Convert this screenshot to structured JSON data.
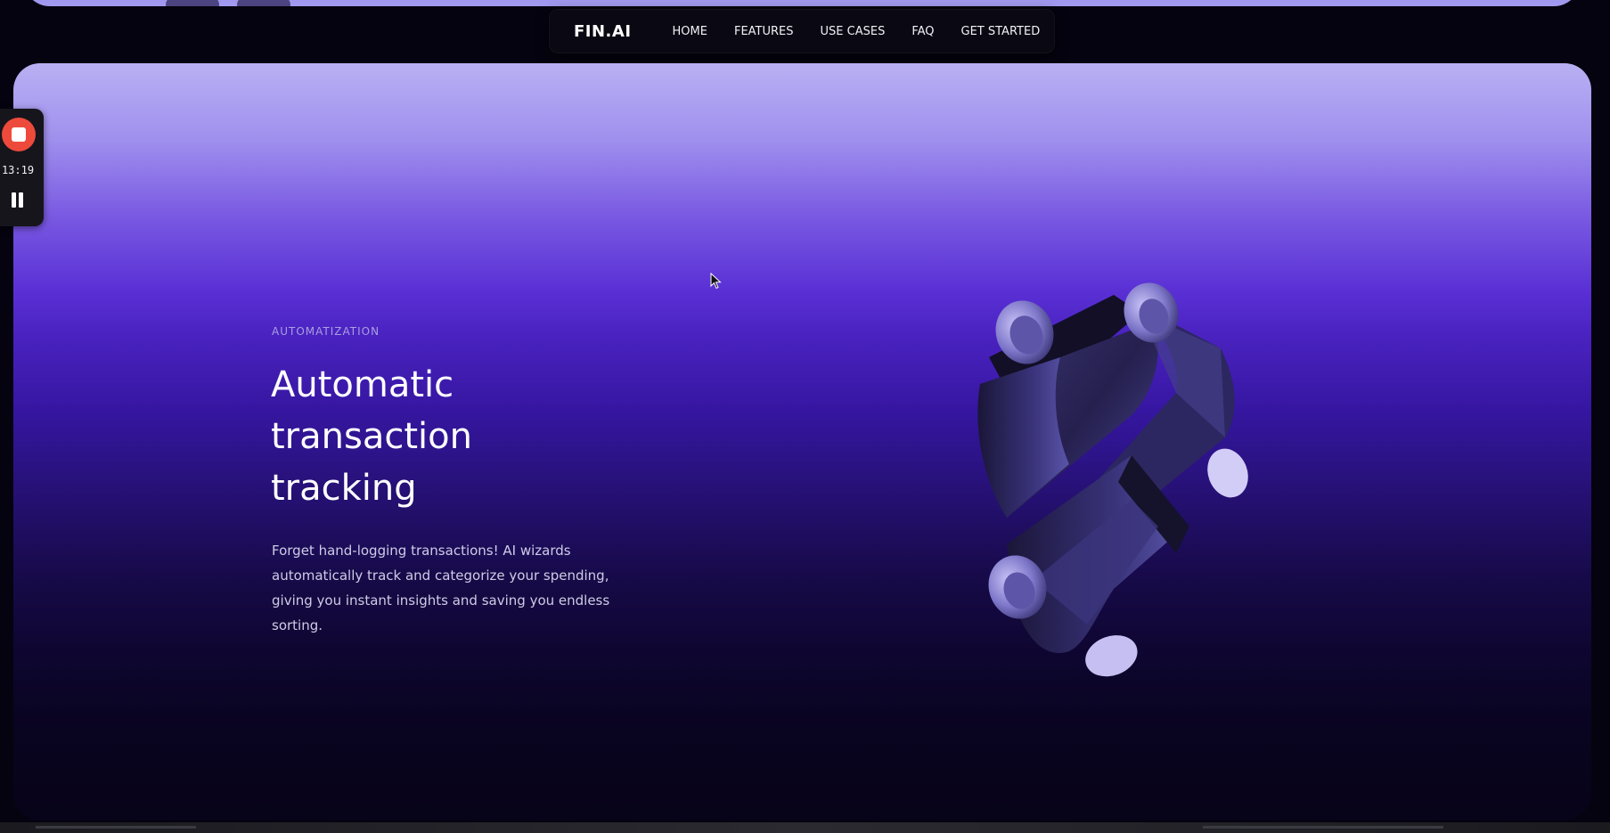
{
  "nav": {
    "logo": "FIN.AI",
    "items": [
      {
        "label": "HOME"
      },
      {
        "label": "FEATURES"
      },
      {
        "label": "USE CASES"
      },
      {
        "label": "FAQ"
      },
      {
        "label": "GET STARTED"
      }
    ]
  },
  "hero": {
    "eyebrow": "AUTOMATIZATION",
    "headline_lines": [
      "Automatic",
      "transaction",
      "tracking"
    ],
    "body_lines": [
      "Forget hand-logging transactions! AI wizards",
      "automatically track and categorize your spending,",
      "giving you instant insights and saving you endless",
      "sorting."
    ]
  },
  "recorder": {
    "elapsed": "13:19"
  },
  "colors": {
    "accent": "#5a30d5",
    "hero_top": "#b8b0f3",
    "hero_bottom": "#070318",
    "record_red": "#ee4a3c",
    "nav_bg": "#0a0812"
  },
  "icons": {
    "record_stop": "stop-icon",
    "record_pause": "pause-icon",
    "cursor": "mouse-pointer-icon",
    "hero_art": "3d-ribbon-logo"
  }
}
